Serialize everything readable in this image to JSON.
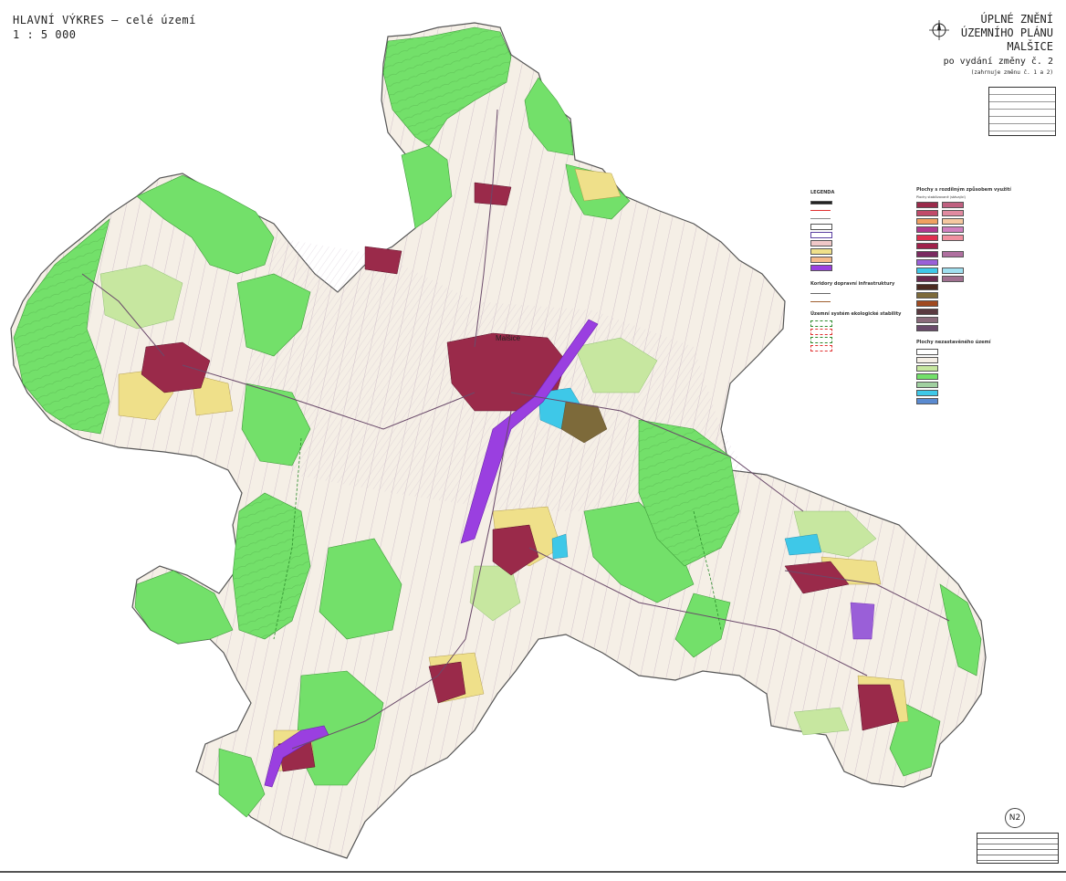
{
  "header_left": {
    "title": "HLAVNÍ VÝKRES – celé území",
    "scale": "1 : 5 000"
  },
  "header_right": {
    "line1": "ÚPLNÉ ZNĚNÍ",
    "line2": "ÚZEMNÍHO PLÁNU",
    "line3": "MALŠICE",
    "line4": "po vydání změny č. 2",
    "line5": "(zahrnuje změnu č. 1 a 2)"
  },
  "map": {
    "town_label": "Malšice",
    "colors": {
      "forest": "#73e06a",
      "meadow": "#c7e7a0",
      "arable": "#f4eee4",
      "built": "#9a2a4a",
      "housing": "#efe08a",
      "corridor": "#9a3fe0",
      "water": "#3ec8e8",
      "boundary": "#555555"
    }
  },
  "legend": {
    "title": "LEGENDA",
    "section_transport": "Koridory dopravní infrastruktury",
    "section_ecology": "Územní systém ekologické stability",
    "section_areas": "Plochy s rozdílným způsobem využití",
    "section_areas_sub": "Plochy stabilizované (stávající)",
    "section_unbuilt": "Plochy nezastavěného území"
  },
  "sheet_id": "N2"
}
